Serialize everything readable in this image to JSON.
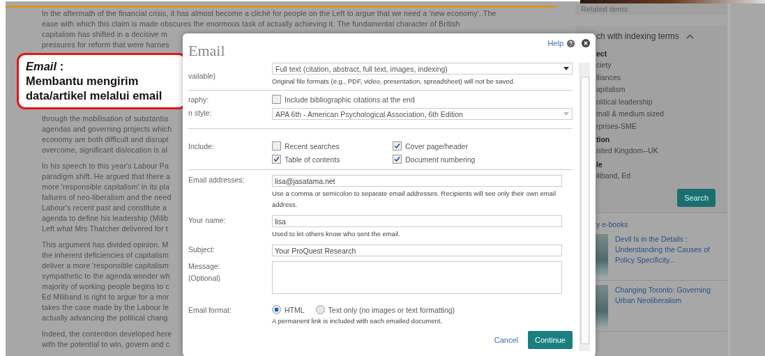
{
  "article": {
    "blocks": [
      {
        "kind": "paragraph",
        "lines": [
          "In the aftermath of the financial crisis, it has almost become a cliché for people on the Left to argue that we need a 'new economy'. The",
          "ease with which this claim is made obscures the enormous task of actually achieving it. The fundamental character of British",
          "capitalism has shifted in a decisive m",
          "pressures for reform that were harnes"
        ]
      },
      {
        "kind": "callout",
        "title": "Email",
        "separator": ":",
        "lines": [
          "Membantu mengirim",
          "data/artikel melalui email"
        ]
      },
      {
        "kind": "paragraph",
        "lines": [
          "through the mobilisation of substantia",
          "agendas and governing projects which",
          "economy are both difficult and disrupt",
          "overcome, significant dislocation is al"
        ]
      },
      {
        "kind": "paragraph",
        "lines": [
          "In his speech to this year's Labour Pa",
          "paradigm shift. He argued that there a",
          "more 'responsible capitalism' in its pla",
          "failures of neo-liberalism and the need",
          "Labour's recent past and constitute a",
          "agenda to define his leadership (Milib",
          "Left what Mrs Thatcher delivered for t"
        ]
      },
      {
        "kind": "paragraph",
        "lines": [
          "This argument has divided opinion. M",
          "the inherent deficiencies of capitalism",
          "deliver a more 'responsible capitalism",
          "sympathetic to the agenda wonder wh",
          "majority of working people begins to c",
          "Ed Miliband is right to argue for a mor",
          "takes the case made by the Labour le",
          "actually advancing the political chang"
        ]
      },
      {
        "kind": "paragraph",
        "lines": [
          "Indeed, the contention developed here",
          "with the potential to win, govern and c"
        ]
      }
    ]
  },
  "sidebar": {
    "related_title": "Related items",
    "indexing": {
      "title": "ch with indexing terms",
      "expanded": true,
      "groups": [
        {
          "heading": "ect",
          "terms": [
            "ciety",
            "lliances",
            "apitalism",
            "olitical leadership",
            "mall & medium sized",
            "rprises-SME"
          ]
        },
        {
          "heading": "tion",
          "terms": [
            "nited Kingdom--UK"
          ]
        },
        {
          "heading": "le",
          "terms": [
            "iliband, Ed"
          ]
        }
      ],
      "button": "Search"
    },
    "ebooks": {
      "title": "y e-books",
      "books": [
        "Devil Is in the Details : Understanding the Causes of Policy Specificity...",
        "Changing Toronto: Governing Urban Neoliberalism"
      ]
    }
  },
  "dialog": {
    "title": "Email",
    "help": "Help",
    "content_row": {
      "label": "vailable)",
      "value": "Full text (citation, abstract, full text, images, indexing)",
      "note": "Original file formats (e.g., PDF, video, presentation, spreadsheet) will not be saved."
    },
    "bibliography": {
      "label": "raphy:",
      "checkbox": {
        "label": "Include bibliographic citations at the end",
        "checked": false
      }
    },
    "citation_style": {
      "label": "n style:",
      "value": "APA 6th - American Psychological Association, 6th Edition"
    },
    "include": {
      "label": "Include:",
      "options": [
        {
          "label": "Recent searches",
          "checked": false
        },
        {
          "label": "Cover page/header",
          "checked": true
        },
        {
          "label": "Table of contents",
          "checked": true
        },
        {
          "label": "Document numbering",
          "checked": true
        }
      ]
    },
    "fields": [
      {
        "kind": "input",
        "label": "Email addresses:",
        "value": "lisa@jasatama.net",
        "hint": "Use a comma or semicolon to separate email addresses. Recipients will see only their own email address."
      },
      {
        "kind": "input",
        "label": "Your name:",
        "value": "lisa",
        "hint": "Used to let others know who sent the email."
      },
      {
        "kind": "input",
        "label": "Subject:",
        "value": "Your ProQuest Research"
      },
      {
        "kind": "textarea",
        "label": "Message:",
        "sublabel": "(Optional)"
      }
    ],
    "format": {
      "label": "Email format:",
      "options": [
        {
          "label": "HTML",
          "selected": true
        },
        {
          "label": "Text only (no images or text formatting)",
          "selected": false
        }
      ],
      "note": "A permanent link is included with each emailed document."
    },
    "cancel": "Cancel",
    "continue": "Continue"
  }
}
